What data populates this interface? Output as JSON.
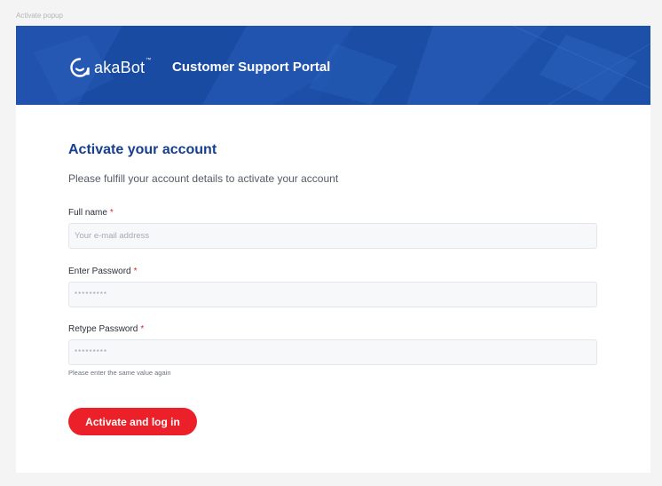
{
  "frame": {
    "label": "Activate popup"
  },
  "header": {
    "brand": "akaBot",
    "brand_tm": "™",
    "title": "Customer Support Portal",
    "background_color": "#1d4fa8"
  },
  "form": {
    "heading": "Activate your account",
    "subheading": "Please fulfill your account details to activate your account",
    "required_marker": "*",
    "full_name": {
      "label": "Full name",
      "placeholder": "Your e-mail address"
    },
    "password": {
      "label": "Enter Password",
      "placeholder": "*********"
    },
    "retype_password": {
      "label": "Retype Password",
      "placeholder": "*********",
      "hint": "Please enter the same value again"
    },
    "submit_label": "Activate and log in",
    "accent_color": "#ec2029",
    "heading_color": "#163f8f"
  }
}
